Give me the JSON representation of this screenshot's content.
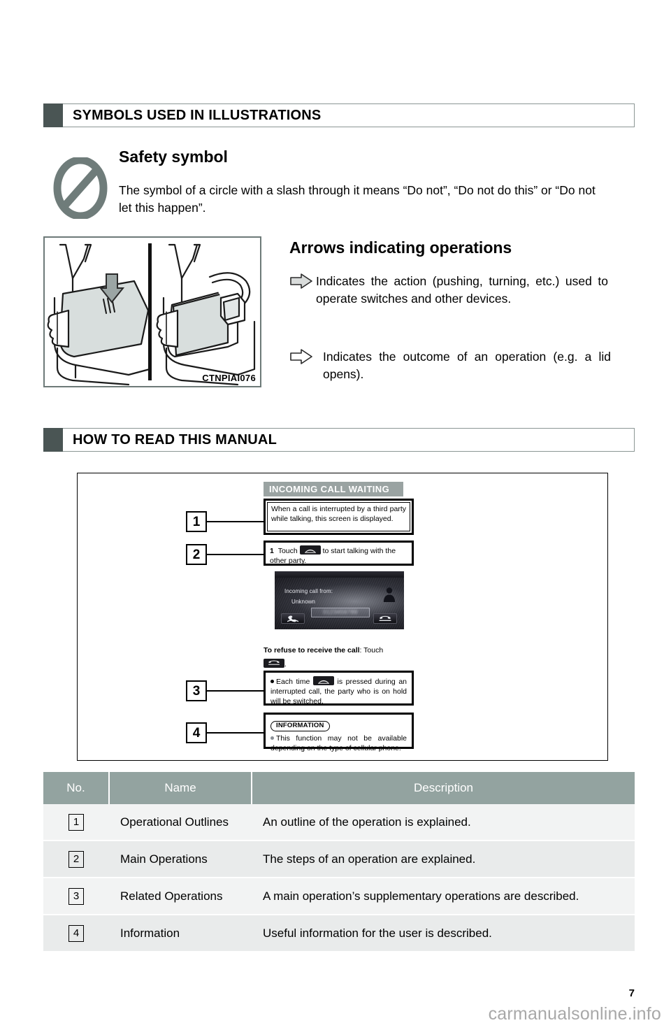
{
  "sections": [
    {
      "title": "SYMBOLS USED IN ILLUSTRATIONS"
    },
    {
      "title": "HOW TO READ THIS MANUAL"
    }
  ],
  "safety": {
    "heading": "Safety symbol",
    "body": "The symbol of a circle with a slash through it means “Do not”, “Do not do this” or “Do not let this happen”.",
    "icon": "prohibition-icon"
  },
  "illustration": {
    "code": "CTNPIAI076",
    "icon": "console-lid-illustration"
  },
  "arrows": {
    "heading": "Arrows indicating operations",
    "items": [
      {
        "icon": "filled-right-arrow-icon",
        "text": "Indicates the action (pushing, turning, etc.) used to operate switches and other devices."
      },
      {
        "icon": "outline-right-arrow-icon",
        "text": "Indicates the outcome of an operation (e.g. a lid opens)."
      }
    ]
  },
  "diagram": {
    "screen_title": "INCOMING CALL WAITING",
    "box1": "When a call is interrupted by a third party while talking, this screen is displayed.",
    "box2_step": "1",
    "box2_pre": "Touch",
    "box2_post": "to start talking with the other party.",
    "phone_screen": {
      "caller_label": "Incoming call from:",
      "caller_name": "Unknown",
      "number": "0123456789",
      "answer_icon": "phone-answer-icon",
      "hangup-icon": "phone-hangup-icon",
      "avatar_icon": "person-silhouette-icon"
    },
    "refuse_bold": "To refuse to receive the call",
    "refuse_rest": ": Touch",
    "refuse_after": ".",
    "box3_pre": "Each time",
    "box3_post": "is pressed during an interrupted call, the party who is on hold will be switched.",
    "info_tag": "INFORMATION",
    "box4": "This function may not be available depending on the type of cellular phone.",
    "callouts": [
      "1",
      "2",
      "3",
      "4"
    ]
  },
  "table": {
    "headers": [
      "No.",
      "Name",
      "Description"
    ],
    "rows": [
      {
        "no": "1",
        "name": "Operational Outlines",
        "desc": "An outline of the operation is explained."
      },
      {
        "no": "2",
        "name": "Main Operations",
        "desc": "The steps of an operation are explained."
      },
      {
        "no": "3",
        "name": "Related Operations",
        "desc": "A main operation’s supplementary operations are described."
      },
      {
        "no": "4",
        "name": "Information",
        "desc": "Useful information for the user is described."
      }
    ]
  },
  "footer": {
    "page_number": "7",
    "watermark": "carmanualsonline.info"
  },
  "colors": {
    "header_square": "#4a5554",
    "table_header": "#93a3a0",
    "screen_title_bg": "#9aa3a2",
    "safety_icon": "#6f7c7a"
  }
}
